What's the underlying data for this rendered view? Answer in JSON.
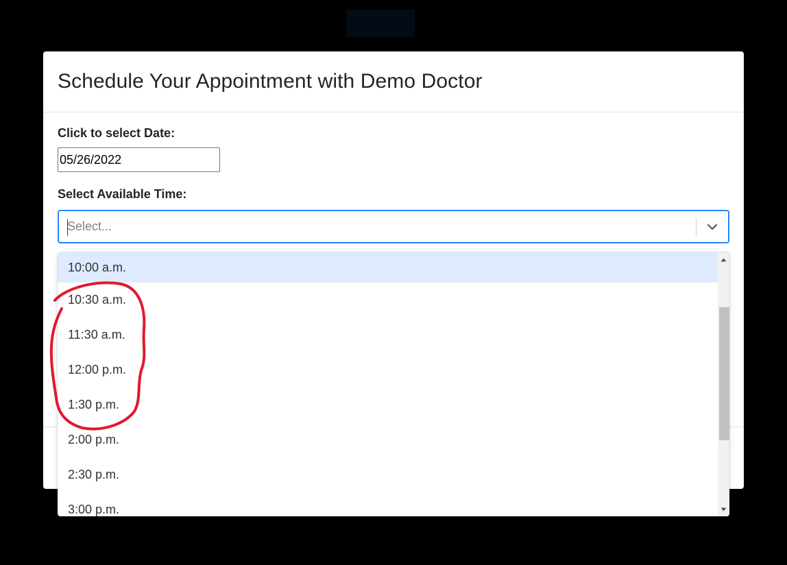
{
  "modal": {
    "title": "Schedule Your Appointment with Demo Doctor"
  },
  "date_field": {
    "label": "Click to select Date:",
    "value": "05/26/2022"
  },
  "time_field": {
    "label": "Select Available Time:",
    "placeholder": "Select..."
  },
  "time_options": [
    "10:00 a.m.",
    "10:30 a.m.",
    "11:30 a.m.",
    "12:00 p.m.",
    "1:30 p.m.",
    "2:00 p.m.",
    "2:30 p.m.",
    "3:00 p.m."
  ],
  "colors": {
    "focus_border": "#2684ff",
    "option_highlight": "#deebff",
    "annotation_red": "#e0192e"
  },
  "icons": {
    "dropdown": "chevron-down-icon",
    "scroll_up": "triangle-up-icon",
    "scroll_down": "triangle-down-icon"
  }
}
